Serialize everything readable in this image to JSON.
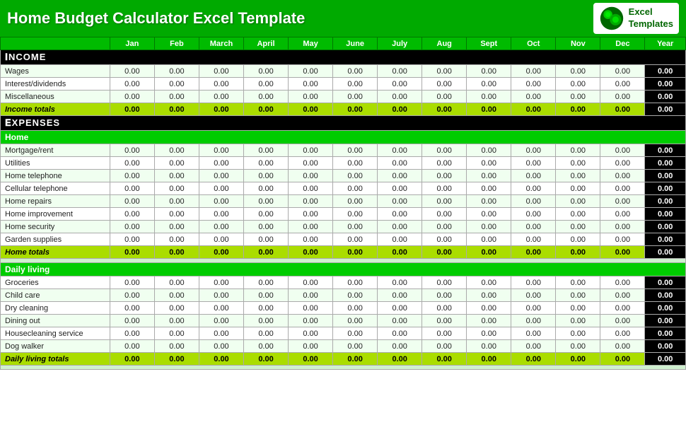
{
  "header": {
    "title": "Home Budget Calculator Excel Template",
    "logo_line1": "Excel",
    "logo_line2": "Templates"
  },
  "columns": {
    "label": "",
    "months": [
      "Jan",
      "Feb",
      "March",
      "April",
      "May",
      "June",
      "July",
      "Aug",
      "Sept",
      "Oct",
      "Nov",
      "Dec",
      "Year"
    ]
  },
  "sections": {
    "income": {
      "label": "Income",
      "rows": [
        {
          "label": "Wages"
        },
        {
          "label": "Interest/dividends"
        },
        {
          "label": "Miscellaneous"
        }
      ],
      "totals_label": "Income totals"
    },
    "expenses": {
      "label": "Expenses"
    },
    "home": {
      "label": "Home",
      "rows": [
        {
          "label": "Mortgage/rent"
        },
        {
          "label": "Utilities"
        },
        {
          "label": "Home telephone"
        },
        {
          "label": "Cellular telephone"
        },
        {
          "label": "Home repairs"
        },
        {
          "label": "Home improvement"
        },
        {
          "label": "Home security"
        },
        {
          "label": "Garden supplies"
        }
      ],
      "totals_label": "Home totals"
    },
    "daily_living": {
      "label": "Daily living",
      "rows": [
        {
          "label": "Groceries"
        },
        {
          "label": "Child care"
        },
        {
          "label": "Dry cleaning"
        },
        {
          "label": "Dining out"
        },
        {
          "label": "Housecleaning service"
        },
        {
          "label": "Dog walker"
        }
      ],
      "totals_label": "Daily living totals"
    }
  },
  "default_value": "0.00",
  "default_year": "0.00"
}
